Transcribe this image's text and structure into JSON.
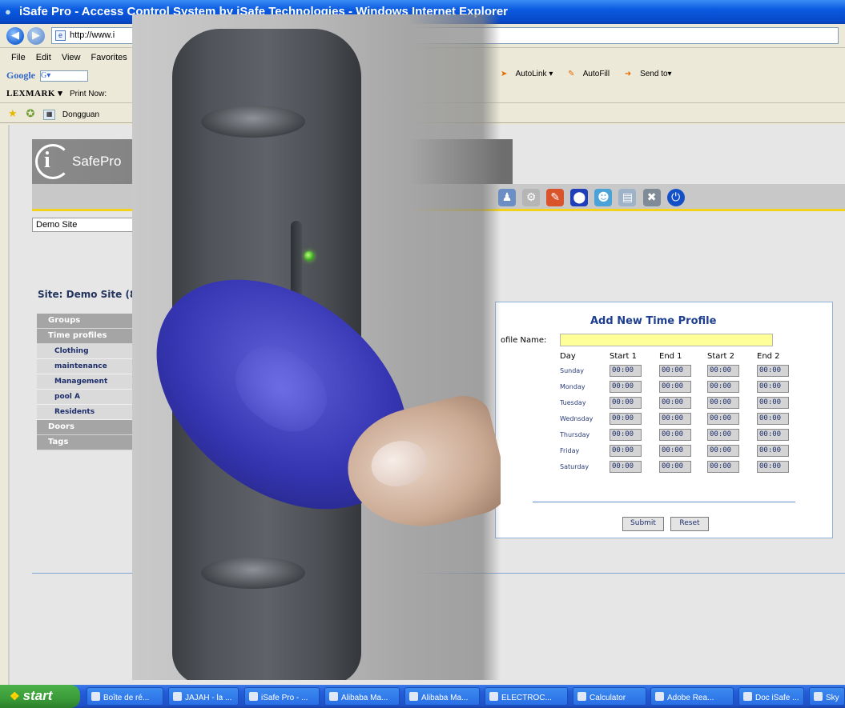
{
  "browser": {
    "title": "iSafe Pro - Access Control System by iSafe Technologies - Windows Internet Explorer",
    "address": "http://www.i",
    "menu": [
      "File",
      "Edit",
      "View",
      "Favorites"
    ],
    "google_label": "Google",
    "google_box": "G▾",
    "google_tools": [
      "AutoLink ▾",
      "AutoFill",
      "Send to▾"
    ],
    "lexmark_label": "LEXMARK ▾",
    "print_now_label": "Print Now:",
    "tab_title": "Dongguan"
  },
  "app": {
    "logo_text": "SafePro",
    "site_select": "Demo Site",
    "site_title": "Site: Demo Site (8",
    "nav": {
      "groups": "Groups",
      "time_profiles": "Time profiles",
      "profiles": [
        "Clothing",
        "maintenance",
        "Management",
        "pool A",
        "Residents"
      ],
      "doors": "Doors",
      "tags": "Tags"
    }
  },
  "form": {
    "title": "Add New Time Profile",
    "profile_name_label": "ofile Name:",
    "columns": [
      "Day",
      "Start 1",
      "End 1",
      "Start 2",
      "End 2"
    ],
    "days": [
      "Sunday",
      "Monday",
      "Tuesday",
      "Wednsday",
      "Thursday",
      "Friday",
      "Saturday"
    ],
    "default_time": "00:00",
    "submit_label": "Submit",
    "reset_label": "Reset"
  },
  "taskbar": {
    "start_label": "start",
    "tasks": [
      "Boîte de ré...",
      "JAJAH - la ...",
      "iSafe Pro - ...",
      "Alibaba Ma...",
      "Alibaba Ma...",
      "ELECTROC...",
      "Calculator",
      "Adobe Rea...",
      "Doc iSafe ...",
      "Sky"
    ]
  },
  "colors": {
    "title_blue": "#0a5ae0",
    "accent_yellow": "#f2d21a",
    "form_title": "#1e3f8f",
    "name_input": "#ffff99",
    "fob_blue": "#3535b2"
  }
}
